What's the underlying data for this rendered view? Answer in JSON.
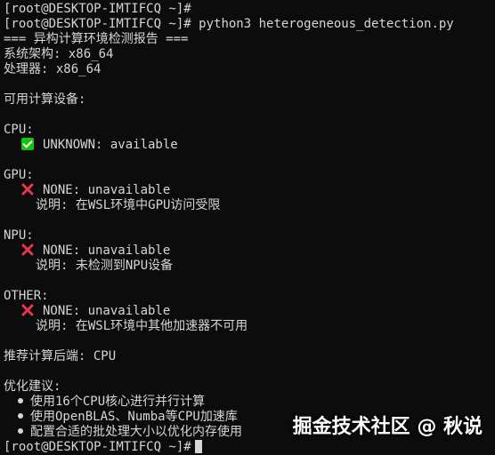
{
  "terminal": {
    "prompt": "[root@DESKTOP-IMTIFCQ ~]#",
    "command": "python3 heterogeneous_detection.py"
  },
  "report": {
    "title": "=== 异构计算环境检测报告 ===",
    "arch": "系统架构: x86_64",
    "processor": "处理器: x86_64",
    "devices_heading": "可用计算设备:",
    "cpu": {
      "label": "CPU:",
      "status": "UNKNOWN: available"
    },
    "gpu": {
      "label": "GPU:",
      "status": "NONE: unavailable",
      "note": "说明: 在WSL环境中GPU访问受限"
    },
    "npu": {
      "label": "NPU:",
      "status": "NONE: unavailable",
      "note": "说明: 未检测到NPU设备"
    },
    "other": {
      "label": "OTHER:",
      "status": "NONE: unavailable",
      "note": "说明: 在WSL环境中其他加速器不可用"
    },
    "recommended": "推荐计算后端: CPU",
    "suggestions_heading": "优化建议:",
    "suggestions": [
      "使用16个CPU核心进行并行计算",
      "使用OpenBLAS、Numba等CPU加速库",
      "配置合适的批处理大小以优化内存使用"
    ]
  },
  "watermark": "掘金技术社区 @ 秋说",
  "colors": {
    "background": "#0c0c0c",
    "text": "#d6d6d6",
    "check": "#16c60c",
    "cross": "#e8364f"
  },
  "icons": {
    "available": "check-icon",
    "unavailable": "cross-icon"
  }
}
